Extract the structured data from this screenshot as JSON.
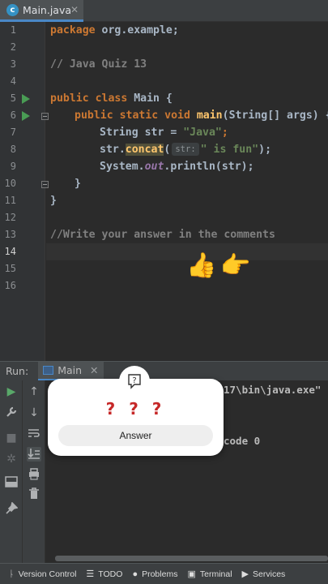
{
  "tab": {
    "icon": "java-class-icon",
    "label": "Main.java",
    "close": "✕"
  },
  "editor": {
    "lines": [
      {
        "num": "1"
      },
      {
        "num": "2"
      },
      {
        "num": "3"
      },
      {
        "num": "4"
      },
      {
        "num": "5"
      },
      {
        "num": "6"
      },
      {
        "num": "7"
      },
      {
        "num": "8"
      },
      {
        "num": "9"
      },
      {
        "num": "10"
      },
      {
        "num": "11"
      },
      {
        "num": "12"
      },
      {
        "num": "13"
      },
      {
        "num": "14"
      },
      {
        "num": "15"
      },
      {
        "num": "16"
      }
    ],
    "code": {
      "l1_kw": "package",
      "l1_rest": " org.example;",
      "l3": "// Java Quiz 13",
      "l5_kw": "public class",
      "l5_name": " Main {",
      "l6_kw": "public static void",
      "l6_fn": " main",
      "l6_rest": "(String[] args) {",
      "l7_type": "String str = ",
      "l7_str": "\"Java\"",
      "l7_end": ";",
      "l8_a": "str.",
      "l8_fn": "concat",
      "l8_paren": "(",
      "l8_hint": "str:",
      "l8_str": "\" is fun\"",
      "l8_end": ");",
      "l9_a": "System.",
      "l9_out": "out",
      "l9_b": ".println(str);",
      "l10": "}",
      "l11": "}",
      "l13": "//Write your answer in the comments"
    },
    "emoji": {
      "thumbs": "👍",
      "point": "👉"
    }
  },
  "run_panel": {
    "label": "Run:",
    "tab_label": "Main",
    "close": "✕",
    "output_line1": "17\\bin\\java.exe\"",
    "output_line2": "code 0"
  },
  "popup": {
    "question_marks": "? ? ?",
    "answer_button": "Answer"
  },
  "statusbar": {
    "items": [
      {
        "icon": "version-control-icon",
        "label": "Version Control"
      },
      {
        "icon": "todo-icon",
        "label": "TODO"
      },
      {
        "icon": "problems-icon",
        "label": "Problems"
      },
      {
        "icon": "terminal-icon",
        "label": "Terminal"
      },
      {
        "icon": "services-icon",
        "label": "Services"
      }
    ]
  }
}
